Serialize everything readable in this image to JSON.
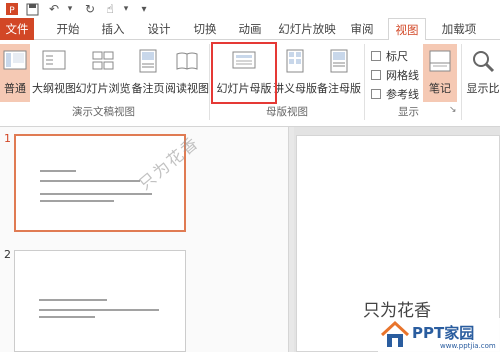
{
  "tabs": [
    {
      "label": "文件",
      "style": "file"
    },
    {
      "label": "开始"
    },
    {
      "label": "插入"
    },
    {
      "label": "设计"
    },
    {
      "label": "切换"
    },
    {
      "label": "动画"
    },
    {
      "label": "幻灯片放映"
    },
    {
      "label": "审阅"
    },
    {
      "label": "视图",
      "style": "active"
    },
    {
      "label": "加载项"
    }
  ],
  "ribbon": {
    "presentation_views": {
      "group_label": "演示文稿视图",
      "buttons": [
        "普通",
        "大纲视图",
        "幻灯片浏览",
        "备注页",
        "阅读视图"
      ]
    },
    "master_views": {
      "group_label": "母版视图",
      "buttons": [
        "幻灯片母版",
        "讲义母版",
        "备注母版"
      ]
    },
    "show": {
      "group_label": "显示",
      "checkboxes": [
        "标尺",
        "网格线",
        "参考线"
      ],
      "notes_button": "笔记"
    },
    "zoom": {
      "button": "显示比"
    }
  },
  "slides": [
    {
      "number": "1",
      "selected": true
    },
    {
      "number": "2",
      "selected": false
    }
  ],
  "watermarks": {
    "diagonal": "只为花香",
    "corner": "只为花香"
  },
  "logo": {
    "title": "PPT家园",
    "subtitle": "www.pptjia.com"
  },
  "colors": {
    "accent": "#d24726",
    "highlight": "#e53935",
    "selected_button": "#f5c9b4"
  }
}
